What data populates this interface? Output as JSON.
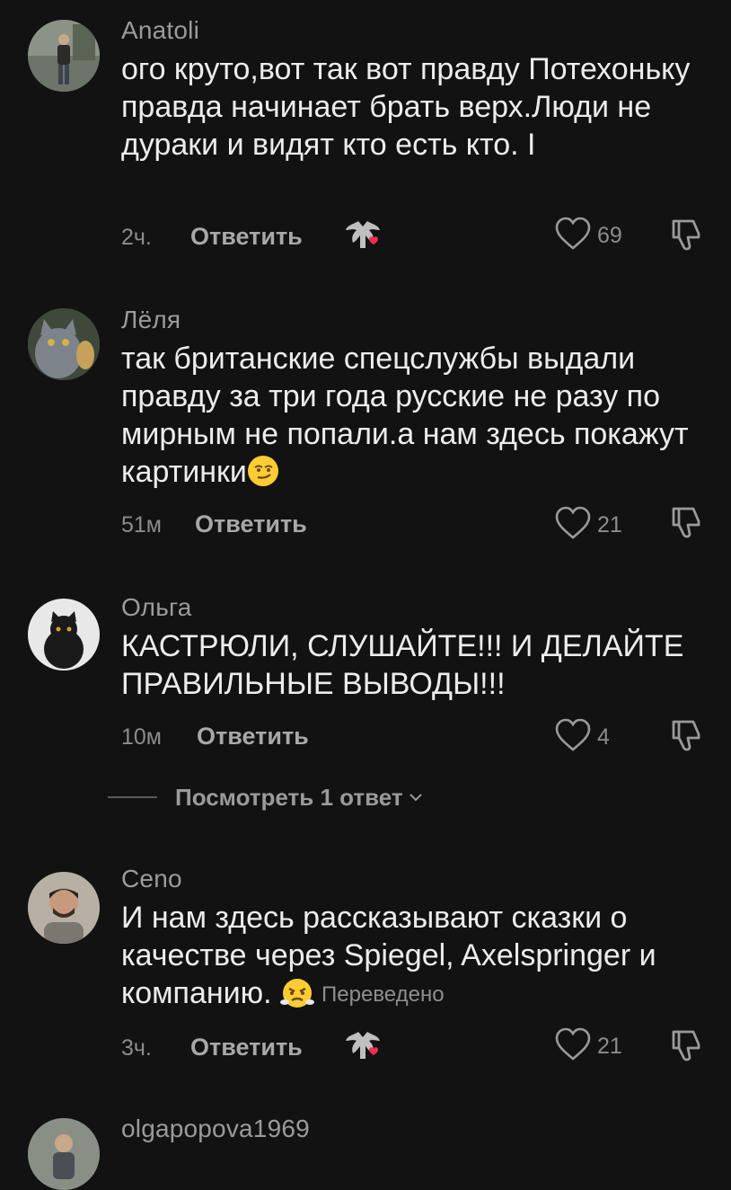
{
  "comments": [
    {
      "username": "Anatoli",
      "text": "ого круто,вот так вот правду Потехоньку правда начинает брать верх.Люди не дураки и видят кто есть кто. I",
      "time": "2ч.",
      "reply_label": "Ответить",
      "likes": "69",
      "creator_liked": true,
      "avatar_icon": "person-standing-avatar"
    },
    {
      "username": "Лёля",
      "text": "так британские спецслужбы выдали правду за три года русские не разу по мирным не попали.а нам здесь покажут картинки",
      "emoji": "smirk-emoji",
      "time": "51м",
      "reply_label": "Ответить",
      "likes": "21",
      "avatar_icon": "cat-avatar"
    },
    {
      "username": "Ольга",
      "text": "КАСТРЮЛИ, СЛУШАЙТЕ!!! И ДЕЛАЙТЕ ПРАВИЛЬНЫЕ ВЫВОДЫ!!!",
      "time": "10м",
      "reply_label": "Ответить",
      "likes": "4",
      "avatar_icon": "black-cat-avatar",
      "view_replies": "Посмотреть 1 ответ"
    },
    {
      "username": "Ceno",
      "text": "И нам здесь рассказывают сказки о качестве через Spiegel, Axelspringer и компанию.",
      "emoji": "triumph-emoji",
      "translated_label": "Переведено",
      "time": "3ч.",
      "reply_label": "Ответить",
      "likes": "21",
      "creator_liked": true,
      "avatar_icon": "man-avatar"
    },
    {
      "username": "olgapopova1969",
      "avatar_icon": "person-avatar"
    }
  ],
  "colors": {
    "background": "#121212",
    "text": "#ececec",
    "muted": "#8c8c8c",
    "heart_badge": "#fe2c55"
  }
}
